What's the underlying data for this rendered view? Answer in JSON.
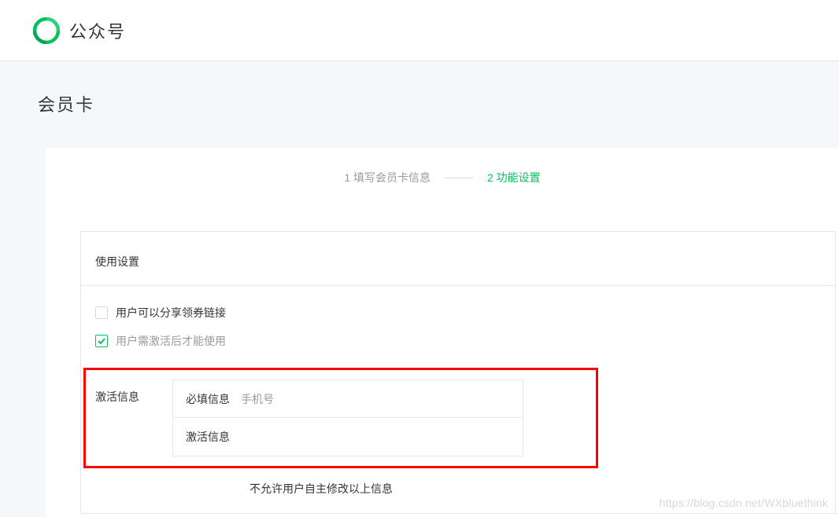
{
  "header": {
    "logo_text": "公众号"
  },
  "page": {
    "title": "会员卡"
  },
  "steps": {
    "step1": "1 填写会员卡信息",
    "step2": "2 功能设置"
  },
  "settings": {
    "section_title": "使用设置",
    "checkbox1": {
      "label": "用户可以分享领券链接",
      "checked": false
    },
    "checkbox2": {
      "label": "用户需激活后才能使用",
      "checked": true
    },
    "activation": {
      "label": "激活信息",
      "rows": [
        {
          "label": "必填信息",
          "value": "手机号"
        },
        {
          "label": "激活信息",
          "value": ""
        }
      ],
      "note": "不允许用户自主修改以上信息"
    }
  },
  "watermark": "https://blog.csdn.net/WXbluethink"
}
